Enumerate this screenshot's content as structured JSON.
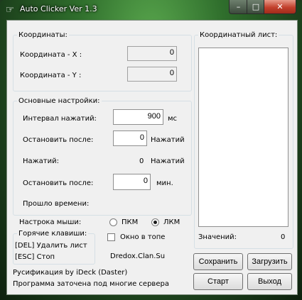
{
  "window": {
    "title": "Auto Clicker Ver 1.3",
    "icon": "cursor-icon",
    "min_glyph": "–",
    "max_glyph": "□",
    "close_glyph": "✕"
  },
  "coords": {
    "legend": "Координаты:",
    "x_label": "Координата - X :",
    "x_value": "0",
    "y_label": "Координата - Y :",
    "y_value": "0"
  },
  "settings": {
    "legend": "Основные настройки:",
    "interval_label": "Интервал нажатий:",
    "interval_value": "900",
    "interval_unit": "мс",
    "stop_after_label": "Остановить после:",
    "stop_after_value": "0",
    "stop_after_unit": "Нажатий",
    "clicks_label": "Нажатий:",
    "clicks_value": "0",
    "clicks_unit": "Нажатий",
    "stop_min_label": "Остановить после:",
    "stop_min_value": "0",
    "stop_min_unit": "мин.",
    "elapsed_label": "Прошло времени:"
  },
  "mouse": {
    "label": "Настрока мыши:",
    "rmb": "ПКМ",
    "lmb": "ЛКМ",
    "selected": "lmb"
  },
  "topmost": {
    "label": "Окно в топе",
    "checked": false
  },
  "hotkeys": {
    "legend": "Горячие клавиши:",
    "del": "[DEL] Удалить лист",
    "esc": "[ESC] Стоп"
  },
  "credits": {
    "site": "Dredox.Clan.Su",
    "localization": "Русификация by iDeck (Daster)",
    "note": "Программа заточена под многие сервера"
  },
  "coord_list": {
    "legend": "Координатный лист:",
    "count_label": "Значений:",
    "count_value": "0"
  },
  "buttons": {
    "save": "Сохранить",
    "load": "Загрузить",
    "start": "Старт",
    "exit": "Выход"
  }
}
